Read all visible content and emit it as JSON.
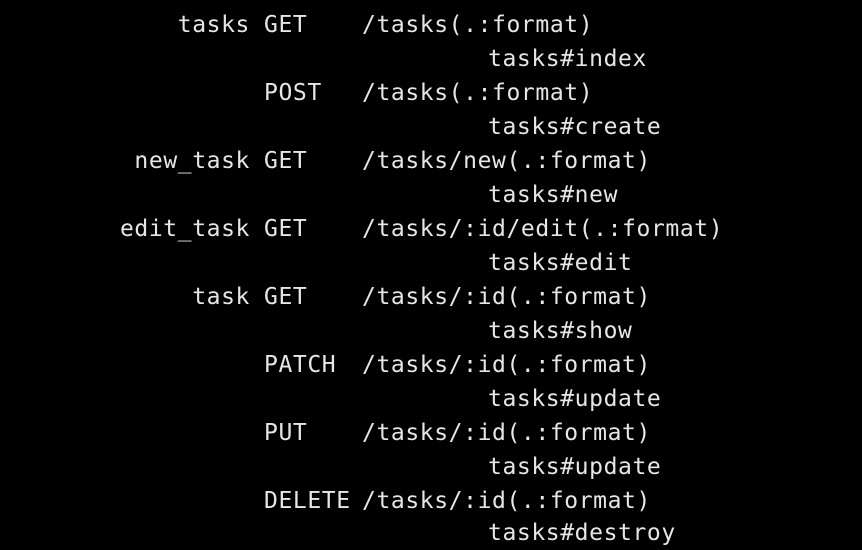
{
  "colors": {
    "background": "#000000",
    "text": "#e6e6e6"
  },
  "routes": [
    {
      "name": "tasks",
      "verb": "GET",
      "path": "/tasks(.:format)",
      "action": "tasks#index"
    },
    {
      "name": "",
      "verb": "POST",
      "path": "/tasks(.:format)",
      "action": "tasks#create"
    },
    {
      "name": "new_task",
      "verb": "GET",
      "path": "/tasks/new(.:format)",
      "action": "tasks#new"
    },
    {
      "name": "edit_task",
      "verb": "GET",
      "path": "/tasks/:id/edit(.:format)",
      "action": "tasks#edit"
    },
    {
      "name": "task",
      "verb": "GET",
      "path": "/tasks/:id(.:format)",
      "action": "tasks#show"
    },
    {
      "name": "",
      "verb": "PATCH",
      "path": "/tasks/:id(.:format)",
      "action": "tasks#update"
    },
    {
      "name": "",
      "verb": "PUT",
      "path": "/tasks/:id(.:format)",
      "action": "tasks#update"
    },
    {
      "name": "",
      "verb": "DELETE",
      "path": "/tasks/:id(.:format)",
      "action": "tasks#destroy"
    }
  ]
}
